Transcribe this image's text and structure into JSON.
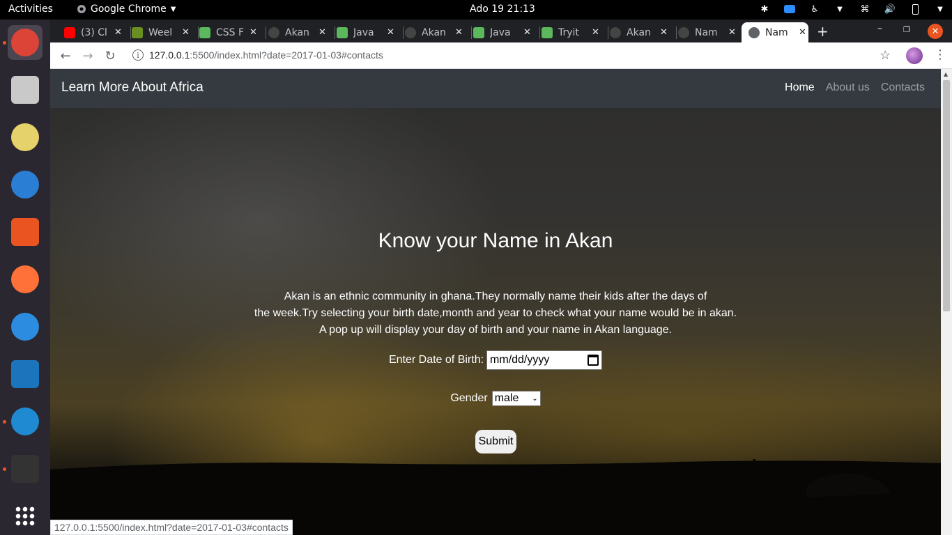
{
  "topbar": {
    "activities": "Activities",
    "app_name": "Google Chrome",
    "clock": "Ado 19  21:13"
  },
  "dock": {
    "items": [
      {
        "name": "chrome-icon",
        "color": "#db4437",
        "running": true,
        "active": true
      },
      {
        "name": "files-icon",
        "color": "#c9c9c9",
        "running": false
      },
      {
        "name": "rhythmbox-icon",
        "color": "#e6d26a",
        "running": false
      },
      {
        "name": "thunderbird-icon",
        "color": "#2a7fd4",
        "running": false
      },
      {
        "name": "software-icon",
        "color": "#e95420",
        "running": false
      },
      {
        "name": "firefox-icon",
        "color": "#ff7139",
        "running": false
      },
      {
        "name": "help-icon",
        "color": "#2c8de0",
        "running": false
      },
      {
        "name": "writer-icon",
        "color": "#1c75bc",
        "running": false
      },
      {
        "name": "vscode-icon",
        "color": "#1f8ad2",
        "running": true
      },
      {
        "name": "terminal-icon",
        "color": "#333333",
        "running": true
      },
      {
        "name": "app-grid-icon",
        "color": "#ffffff",
        "running": false
      }
    ]
  },
  "browser": {
    "tabs": [
      {
        "title": "(3) Cl",
        "favicon_color": "#ff0000"
      },
      {
        "title": "Weel",
        "favicon_color": "#6b8e23"
      },
      {
        "title": "CSS F",
        "favicon_color": "#5cb85c"
      },
      {
        "title": "Akan",
        "favicon_color": "#444444"
      },
      {
        "title": "Java",
        "favicon_color": "#5cb85c"
      },
      {
        "title": "Akan",
        "favicon_color": "#444444"
      },
      {
        "title": "Java",
        "favicon_color": "#5cb85c"
      },
      {
        "title": "Tryit",
        "favicon_color": "#5cb85c"
      },
      {
        "title": "Akan",
        "favicon_color": "#444444"
      },
      {
        "title": "Nam",
        "favicon_color": "#444444"
      },
      {
        "title": "Nam",
        "favicon_color": "#5f6368",
        "active": true
      }
    ],
    "url_host": "127.0.0.1",
    "url_rest": ":5500/index.html?date=2017-01-03#contacts",
    "status_url": "127.0.0.1:5500/index.html?date=2017-01-03#contacts"
  },
  "page": {
    "brand": "Learn More About Africa",
    "nav": [
      "Home",
      "About us",
      "Contacts"
    ],
    "heading": "Know your Name in Akan",
    "desc_lines": [
      "Akan is an ethnic community in ghana.They normally name their kids after the days of",
      "the week.Try selecting your birth date,month and year to check what your name would be in akan.",
      "A pop up will display your day of birth and your name in Akan language."
    ],
    "dob_label": "Enter Date of Birth:",
    "dob_placeholder": "mm/dd/yyyy",
    "gender_label": "Gender",
    "gender_value": "male",
    "submit_label": "Submit"
  }
}
